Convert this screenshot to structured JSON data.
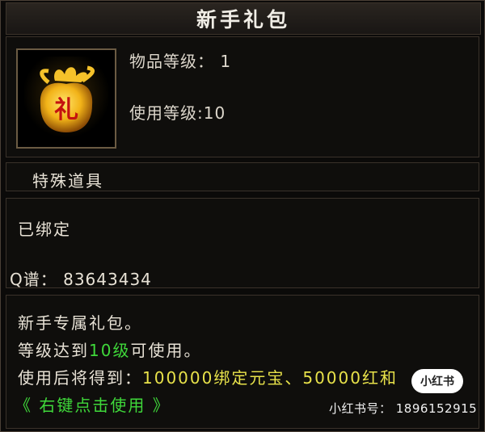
{
  "item": {
    "name": "新手礼包",
    "item_level_label": "物品等级：",
    "item_level": "1",
    "use_level_label": "使用等级:",
    "use_level": "10",
    "type": "特殊道具",
    "bind_status": "已绑定",
    "qq_group": "Q谱： 83643434",
    "desc_line1": "新手专属礼包。",
    "desc_line2_a": "等级达到",
    "desc_line2_b": "10级",
    "desc_line2_c": "可使用。",
    "desc_line3_a": "使用后将得到：",
    "desc_line3_b": "100000绑定元宝、50000红和",
    "hint": "《 右键点击使用 》",
    "icon_glyph": "礼",
    "icon": "gift-bag-icon"
  },
  "watermark": {
    "badge": "小红书",
    "text": "小红书号： 1896152915"
  },
  "colors": {
    "green": "#3fd83a",
    "yellow": "#e8e24a",
    "gold": "#f2b318"
  }
}
